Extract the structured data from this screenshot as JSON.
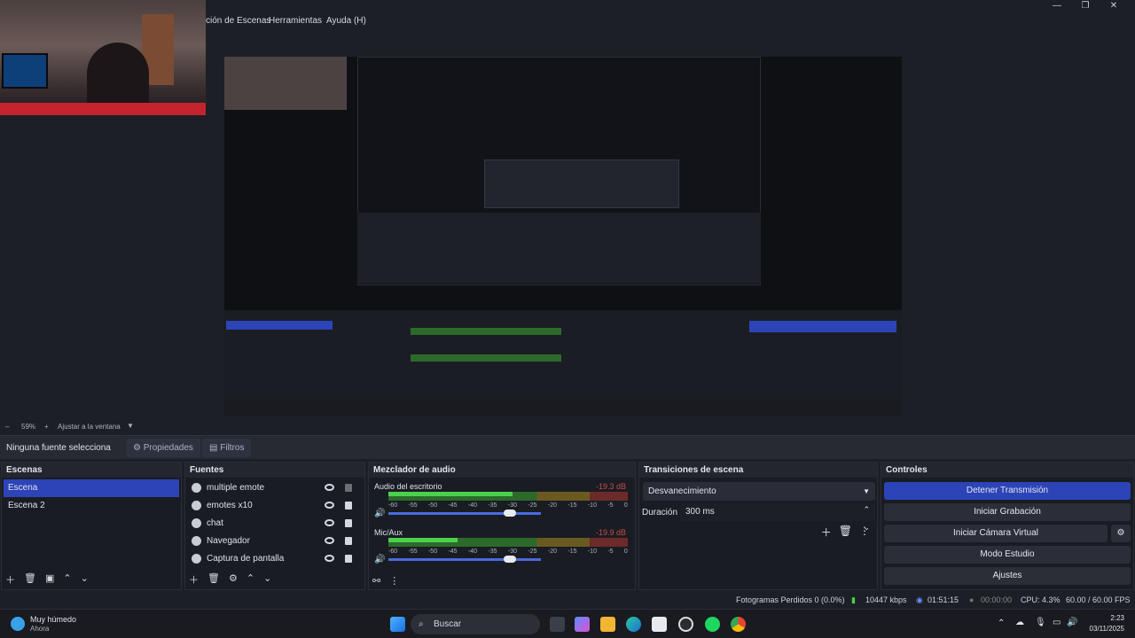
{
  "menu": {
    "items": [
      "ción de Escenas",
      "Herramientas",
      "Ayuda (H)"
    ]
  },
  "window_controls": {
    "minimize": "—",
    "maximize": "❐",
    "close": "✕"
  },
  "zoom": {
    "level": "59%",
    "fit": "Ajustar a la ventana"
  },
  "source_bar": {
    "label": "Ninguna fuente selecciona",
    "properties": "Propiedades",
    "filters": "Filtros"
  },
  "scenes": {
    "title": "Escenas",
    "items": [
      {
        "label": "Escena",
        "active": true
      },
      {
        "label": "Escena 2",
        "active": false
      }
    ]
  },
  "sources": {
    "title": "Fuentes",
    "items": [
      {
        "label": "multiple emote",
        "locked": false
      },
      {
        "label": "emotes x10",
        "locked": true
      },
      {
        "label": "chat",
        "locked": true
      },
      {
        "label": "Navegador",
        "locked": true
      },
      {
        "label": "Captura de pantalla",
        "locked": true
      }
    ]
  },
  "mixer": {
    "title": "Mezclador de audio",
    "channels": [
      {
        "name": "Audio del escritorio",
        "db": "-19.3 dB",
        "level": 0.52,
        "volume": 0.82
      },
      {
        "name": "Mic/Aux",
        "db": "-19.9 dB",
        "level": 0.29,
        "volume": 0.82
      }
    ],
    "ticks": [
      "-60",
      "-55",
      "-50",
      "-45",
      "-40",
      "-35",
      "-30",
      "-25",
      "-20",
      "-15",
      "-10",
      "-5",
      "0"
    ]
  },
  "transitions": {
    "title": "Transiciones de escena",
    "selected": "Desvanecimiento",
    "duration_label": "Duración",
    "duration_value": "300 ms"
  },
  "controls": {
    "title": "Controles",
    "buttons": [
      "Detener Transmisión",
      "Iniciar Grabación",
      "Iniciar Cámara Virtual",
      "Modo Estudio",
      "Ajustes"
    ]
  },
  "status": {
    "dropped": "Fotogramas Perdidos 0 (0.0%)",
    "bitrate": "10447 kbps",
    "stream_time": "01:51:15",
    "rec_time": "00:00:00",
    "cpu": "CPU: 4.3%",
    "fps": "60.00 / 60.00 FPS"
  },
  "taskbar": {
    "weather_title": "Muy húmedo",
    "weather_sub": "Ahora",
    "search": "Buscar",
    "time": "2:23",
    "date": "03/11/2025"
  },
  "colors": {
    "accent": "#2c44b8",
    "bg": "#1d1f26",
    "dock": "#1a1c23"
  }
}
